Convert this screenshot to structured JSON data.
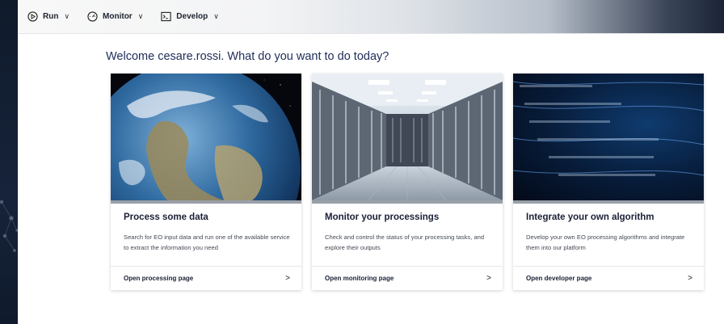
{
  "nav": {
    "items": [
      {
        "label": "Run",
        "icon": "play-circle-icon"
      },
      {
        "label": "Monitor",
        "icon": "gauge-icon"
      },
      {
        "label": "Develop",
        "icon": "terminal-icon"
      }
    ]
  },
  "welcome": "Welcome cesare.rossi. What do you want to do today?",
  "cards": [
    {
      "title": "Process some data",
      "description": "Search for EO input data and run one of the available service to extract the information you need",
      "link": "Open processing page",
      "image": "earth-image"
    },
    {
      "title": "Monitor your processings",
      "description": "Check and control the status of your processing tasks, and explore their outputs",
      "link": "Open monitoring page",
      "image": "server-room-image"
    },
    {
      "title": "Integrate your own algorithm",
      "description": "Develop your own EO processing algorithms and integrate them into our platform",
      "link": "Open developer page",
      "image": "code-image"
    }
  ],
  "colors": {
    "heading": "#1f2d59",
    "card_title": "#1b2036",
    "card_bar": "#9aa0a8"
  }
}
